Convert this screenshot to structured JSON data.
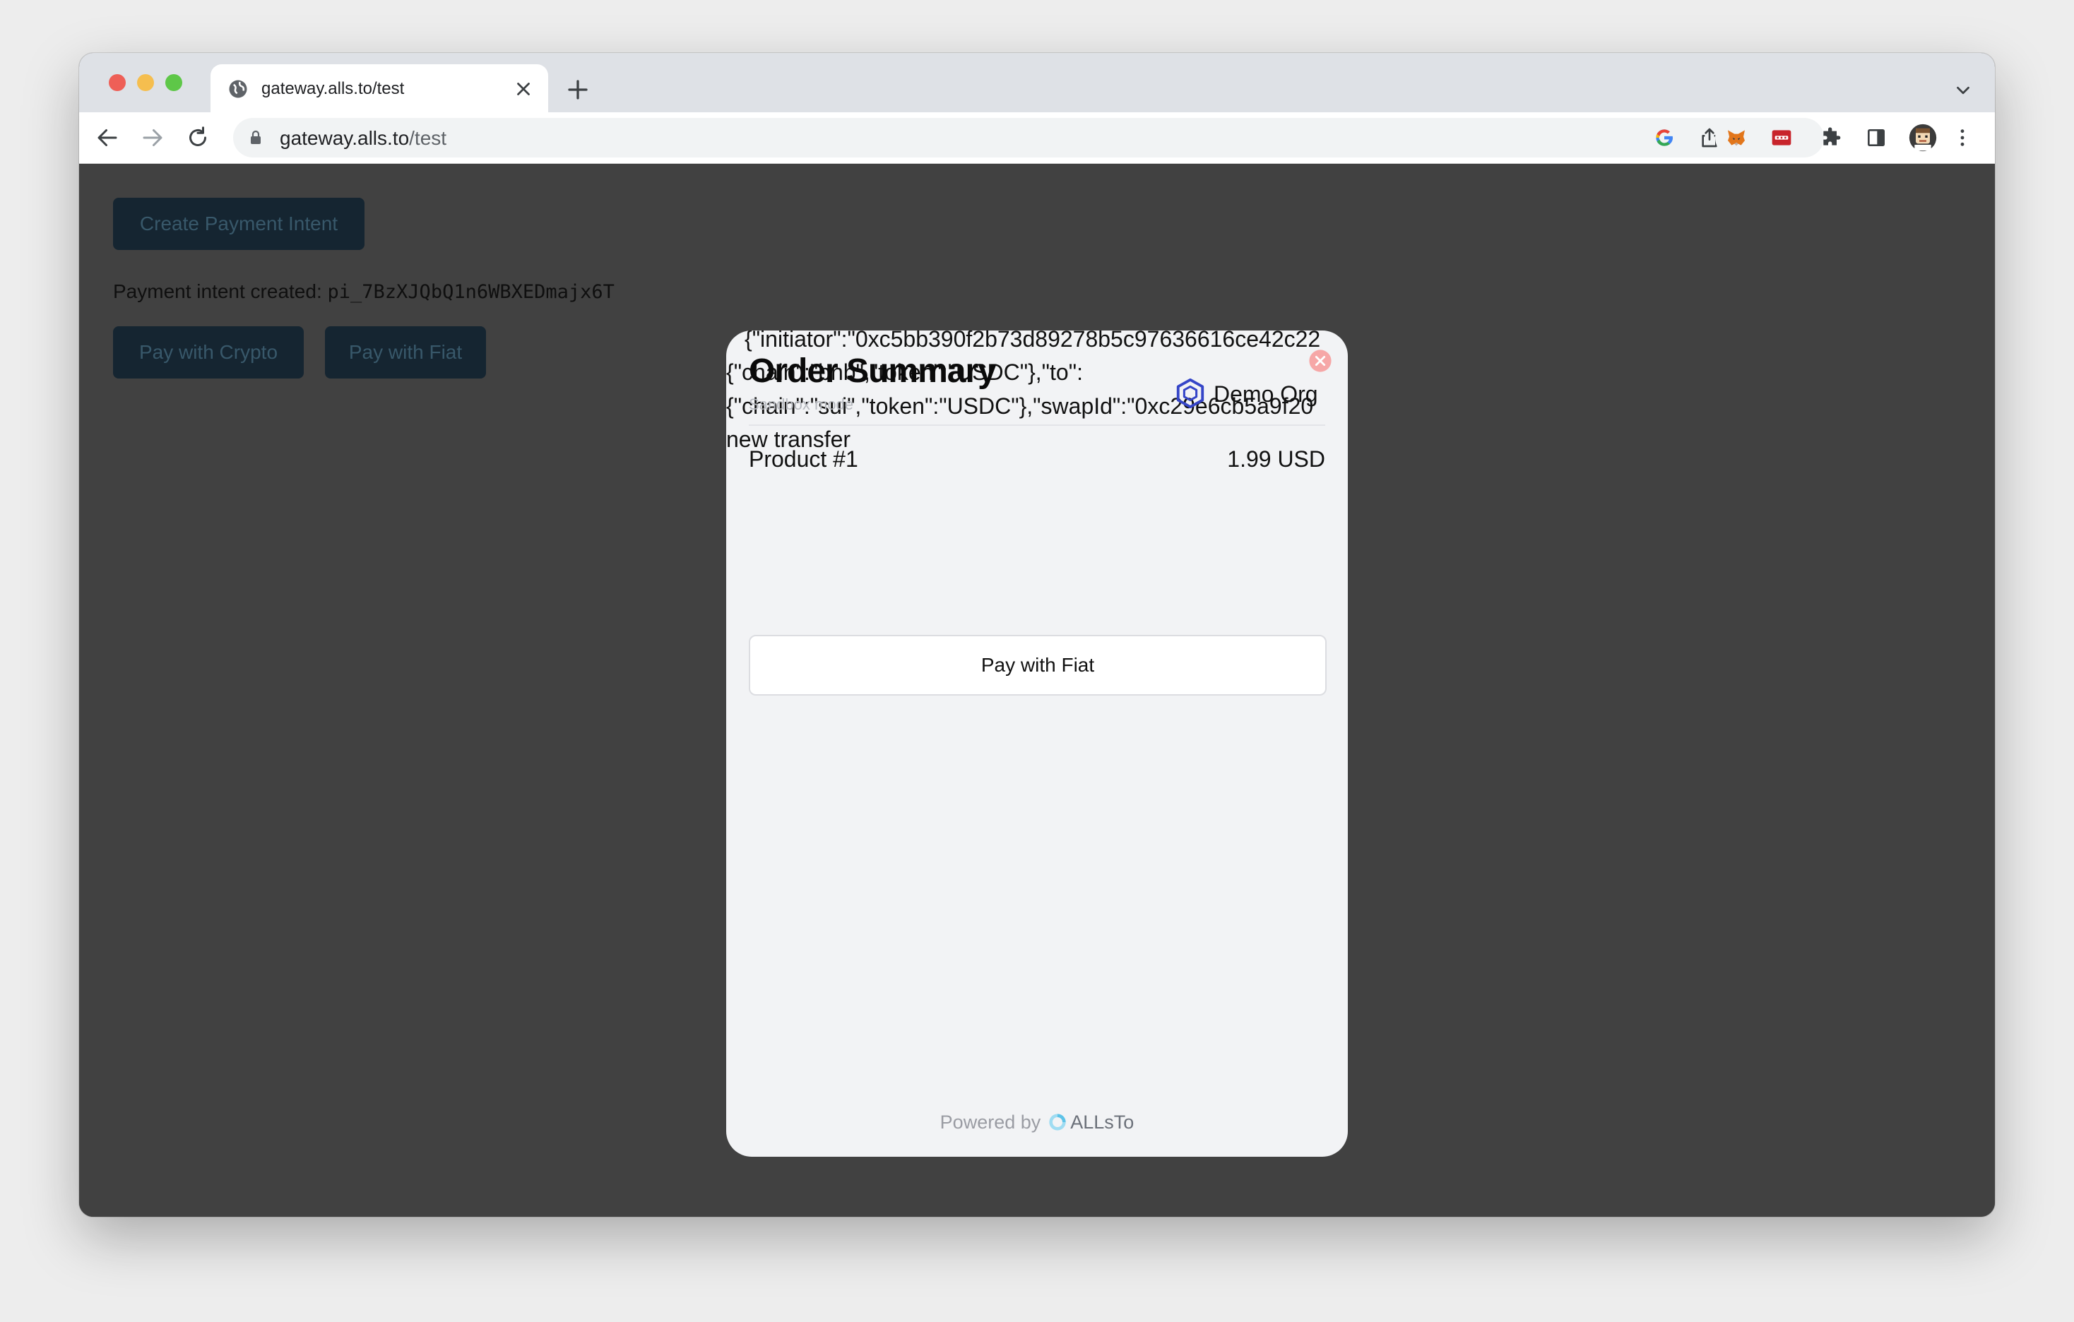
{
  "browser": {
    "tab_title": "gateway.alls.to/test",
    "url_host": "gateway.alls.to",
    "url_path": "/test",
    "icons": [
      "globe-icon",
      "close-icon",
      "plus-icon",
      "chevron-down-icon",
      "back-icon",
      "forward-icon",
      "reload-icon",
      "lock-icon",
      "google-icon",
      "share-icon",
      "star-icon",
      "metamask-icon",
      "password-manager-icon",
      "extensions-icon",
      "side-panel-icon",
      "profile-avatar",
      "more-icon"
    ]
  },
  "page": {
    "create_button": "Create Payment Intent",
    "intent_label": "Payment intent created: ",
    "intent_id": "pi_7BzXJQbQ1n6WBXEDmajx6T",
    "pay_crypto_button": "Pay with Crypto",
    "pay_fiat_button": "Pay with Fiat"
  },
  "modal": {
    "debug_line1": "{\"initiator\":\"0xc5bb390f2b73d89278b5c97636616ce42c22",
    "debug_line2": "{\"chain\":\"bnb\",\"token\":\"USDC\"},\"to\":",
    "debug_line3": "{\"chain\":\"sui\",\"token\":\"USDC\"},\"swapId\":\"0xc29e6cb5a9f20",
    "debug_line4": "new transfer",
    "title": "Order Summary",
    "subtitle": "Sandbox mode",
    "org_name": "Demo Org",
    "product_name": "Product #1",
    "product_price": "1.99 USD",
    "pay_button": "Pay with Fiat",
    "powered_by": "Powered by",
    "brand": "ALLsTo"
  },
  "colors": {
    "page_bg": "#414141",
    "button_bg": "#152531",
    "button_text": "#38586a",
    "modal_bg": "#f2f3f5",
    "close_red": "#f28b8b",
    "org_logo_blue": "#3545c8"
  }
}
